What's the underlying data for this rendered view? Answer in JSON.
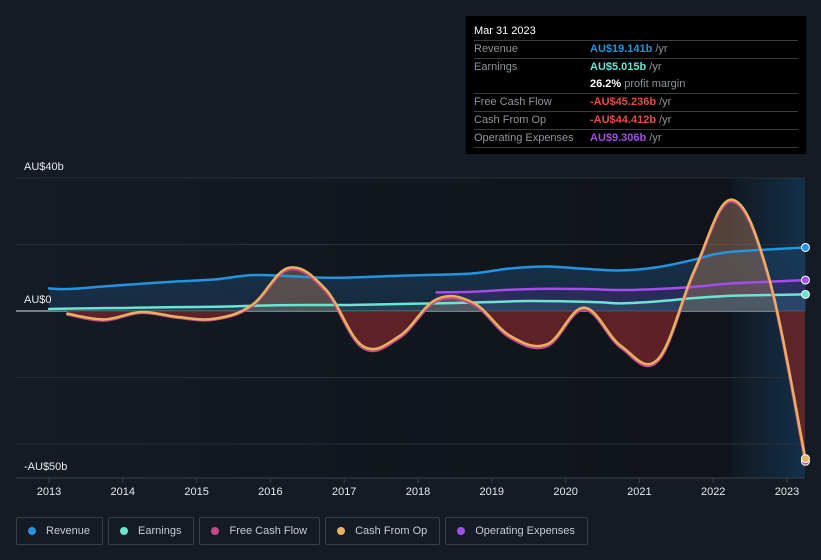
{
  "colors": {
    "revenue": "#2394df",
    "earnings": "#6ce3d3",
    "free_cash_flow": "#c24a87",
    "cash_from_op": "#e8b15e",
    "operating_expenses": "#a24ee8",
    "negative": "#e64b4b",
    "background": "#151b24"
  },
  "tooltip": {
    "date": "Mar 31 2023",
    "rows": [
      {
        "label": "Revenue",
        "value": "AU$19.141b",
        "unit": "/yr",
        "color_key": "revenue"
      },
      {
        "label": "Earnings",
        "value": "AU$5.015b",
        "unit": "/yr",
        "color_key": "earnings"
      },
      {
        "label": "",
        "value": "26.2%",
        "unit": "profit margin",
        "color_key": "margin"
      },
      {
        "label": "Free Cash Flow",
        "value": "-AU$45.236b",
        "unit": "/yr",
        "color_key": "negative"
      },
      {
        "label": "Cash From Op",
        "value": "-AU$44.412b",
        "unit": "/yr",
        "color_key": "negative"
      },
      {
        "label": "Operating Expenses",
        "value": "AU$9.306b",
        "unit": "/yr",
        "color_key": "operating_expenses"
      }
    ]
  },
  "legend": [
    {
      "label": "Revenue",
      "color_key": "revenue"
    },
    {
      "label": "Earnings",
      "color_key": "earnings"
    },
    {
      "label": "Free Cash Flow",
      "color_key": "free_cash_flow"
    },
    {
      "label": "Cash From Op",
      "color_key": "cash_from_op"
    },
    {
      "label": "Operating Expenses",
      "color_key": "operating_expenses"
    }
  ],
  "chart_data": {
    "type": "line",
    "title": "",
    "xlabel": "",
    "ylabel": "",
    "y_unit": "AU$ billions",
    "ylim": [
      -50,
      40
    ],
    "xlim": [
      2012.55,
      2023.25
    ],
    "y_tick_labels": [
      {
        "value": 40,
        "label": "AU$40b"
      },
      {
        "value": 0,
        "label": "AU$0"
      },
      {
        "value": -50,
        "label": "-AU$50b"
      }
    ],
    "y_gridlines": [
      40,
      20,
      0,
      -20,
      -40
    ],
    "x_ticks": [
      2013,
      2014,
      2015,
      2016,
      2017,
      2018,
      2019,
      2020,
      2021,
      2022,
      2023
    ],
    "forecast_shade_start": 2022.25,
    "legend_position": "bottom",
    "series": [
      {
        "name": "Revenue",
        "color_key": "revenue",
        "x": [
          2013.0,
          2013.25,
          2013.75,
          2014.25,
          2014.75,
          2015.25,
          2015.75,
          2016.25,
          2016.75,
          2017.25,
          2017.75,
          2018.25,
          2018.75,
          2019.25,
          2019.75,
          2020.25,
          2020.75,
          2021.25,
          2021.75,
          2022.0,
          2022.25,
          2022.75,
          2023.25
        ],
        "y": [
          6.8,
          6.6,
          7.4,
          8.2,
          8.9,
          9.5,
          10.8,
          10.5,
          10.0,
          10.2,
          10.6,
          10.9,
          11.3,
          12.8,
          13.4,
          12.7,
          12.2,
          13.2,
          15.5,
          17.0,
          17.8,
          18.5,
          19.1
        ]
      },
      {
        "name": "Earnings",
        "color_key": "earnings",
        "x": [
          2013.0,
          2013.5,
          2014.0,
          2014.5,
          2015.0,
          2015.5,
          2016.0,
          2016.5,
          2017.0,
          2017.5,
          2018.0,
          2018.5,
          2019.0,
          2019.5,
          2020.0,
          2020.5,
          2020.75,
          2021.25,
          2021.75,
          2022.25,
          2022.75,
          2023.25
        ],
        "y": [
          0.6,
          0.8,
          0.9,
          1.1,
          1.2,
          1.4,
          1.7,
          1.8,
          1.8,
          2.0,
          2.2,
          2.4,
          2.7,
          3.0,
          2.9,
          2.6,
          2.3,
          2.9,
          3.9,
          4.6,
          4.8,
          5.0
        ]
      },
      {
        "name": "Free Cash Flow",
        "color_key": "free_cash_flow",
        "x": [
          2013.25,
          2013.75,
          2014.25,
          2014.75,
          2015.25,
          2015.75,
          2016.25,
          2016.75,
          2017.25,
          2017.75,
          2018.25,
          2018.75,
          2019.25,
          2019.75,
          2020.25,
          2020.75,
          2021.25,
          2021.75,
          2022.25,
          2022.75,
          2023.25
        ],
        "y": [
          -1.0,
          -2.8,
          -0.5,
          -2.0,
          -2.5,
          1.5,
          12.5,
          6.0,
          -11.0,
          -8.0,
          3.0,
          2.0,
          -8.0,
          -10.5,
          0.5,
          -11.0,
          -15.0,
          12.0,
          33.0,
          10.0,
          -45.2
        ]
      },
      {
        "name": "Cash From Op",
        "color_key": "cash_from_op",
        "x": [
          2013.25,
          2013.75,
          2014.25,
          2014.75,
          2015.25,
          2015.75,
          2016.25,
          2016.75,
          2017.25,
          2017.75,
          2018.25,
          2018.75,
          2019.25,
          2019.75,
          2020.25,
          2020.75,
          2021.25,
          2021.75,
          2022.25,
          2022.75,
          2023.25
        ],
        "y": [
          -0.8,
          -2.5,
          -0.3,
          -1.8,
          -2.3,
          1.8,
          13.0,
          6.5,
          -10.5,
          -7.5,
          3.5,
          2.5,
          -7.5,
          -10.0,
          1.0,
          -10.5,
          -14.5,
          12.5,
          33.5,
          10.5,
          -44.4
        ]
      },
      {
        "name": "Operating Expenses",
        "color_key": "operating_expenses",
        "x": [
          2018.25,
          2018.75,
          2019.25,
          2019.75,
          2020.25,
          2020.75,
          2021.25,
          2021.75,
          2022.25,
          2022.75,
          2023.25
        ],
        "y": [
          5.6,
          5.8,
          6.4,
          6.7,
          6.6,
          6.3,
          6.6,
          7.3,
          8.3,
          8.8,
          9.3
        ]
      }
    ]
  }
}
